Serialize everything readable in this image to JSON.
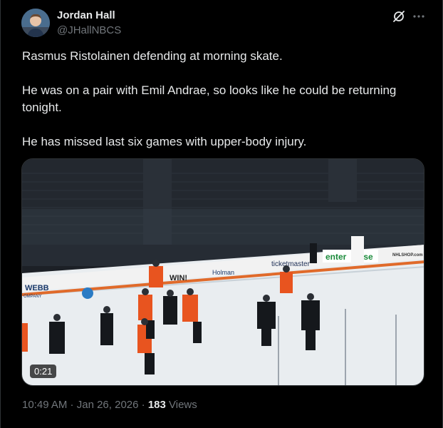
{
  "author": {
    "name": "Jordan Hall",
    "handle": "@JHallNBCS"
  },
  "icons": [
    "grok-icon",
    "more-icon"
  ],
  "tweet": {
    "paragraphs": [
      "Rasmus Ristolainen defending at morning skate.",
      "He was on a pair with Emil Andrae, so looks like he could be returning tonight.",
      "He has missed last six games with upper-body injury."
    ]
  },
  "media": {
    "duration": "0:21",
    "rink_signs": {
      "webb": "WEBB",
      "company": "OMPANY",
      "win": "WIN!",
      "holman": "Holman",
      "ticket": "ticketmaster",
      "enter": "enter",
      "ise": "ise",
      "nhlshop": "NHLSHOP.com"
    }
  },
  "meta": {
    "time": "10:49 AM",
    "separator": " · ",
    "date": "Jan 26, 2026",
    "views_count": "183",
    "views_label": " Views"
  }
}
